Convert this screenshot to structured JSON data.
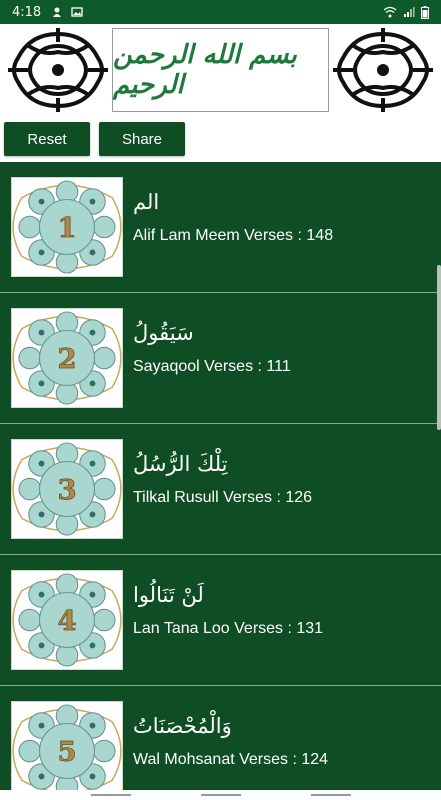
{
  "status_bar": {
    "time": "4:18",
    "icons": [
      "notification-icon",
      "image-icon",
      "wifi-icon",
      "signal-icon",
      "battery-icon"
    ]
  },
  "banner": {
    "calligraphy": "بسم الله الرحمن الرحيم"
  },
  "actions": {
    "reset_label": "Reset",
    "share_label": "Share"
  },
  "colors": {
    "brand_green": "#0f4d24",
    "status_green": "#0f5a2a",
    "medallion_fill": "#a9d6cf",
    "medallion_gold": "#c9a65a"
  },
  "items": [
    {
      "number": "1",
      "arabic": "الم",
      "title": "Alif Lam Meem Verses : 148"
    },
    {
      "number": "2",
      "arabic": "سَيَقُولُ",
      "title": "Sayaqool Verses : 111"
    },
    {
      "number": "3",
      "arabic": "تِلْكَ الرُّسُلُ",
      "title": "Tilkal Rusull Verses : 126"
    },
    {
      "number": "4",
      "arabic": "لَنْ تَنَالُوا",
      "title": "Lan Tana Loo Verses : 131"
    },
    {
      "number": "5",
      "arabic": "وَالْمُحْصَنَاتُ",
      "title": "Wal Mohsanat Verses : 124"
    }
  ]
}
